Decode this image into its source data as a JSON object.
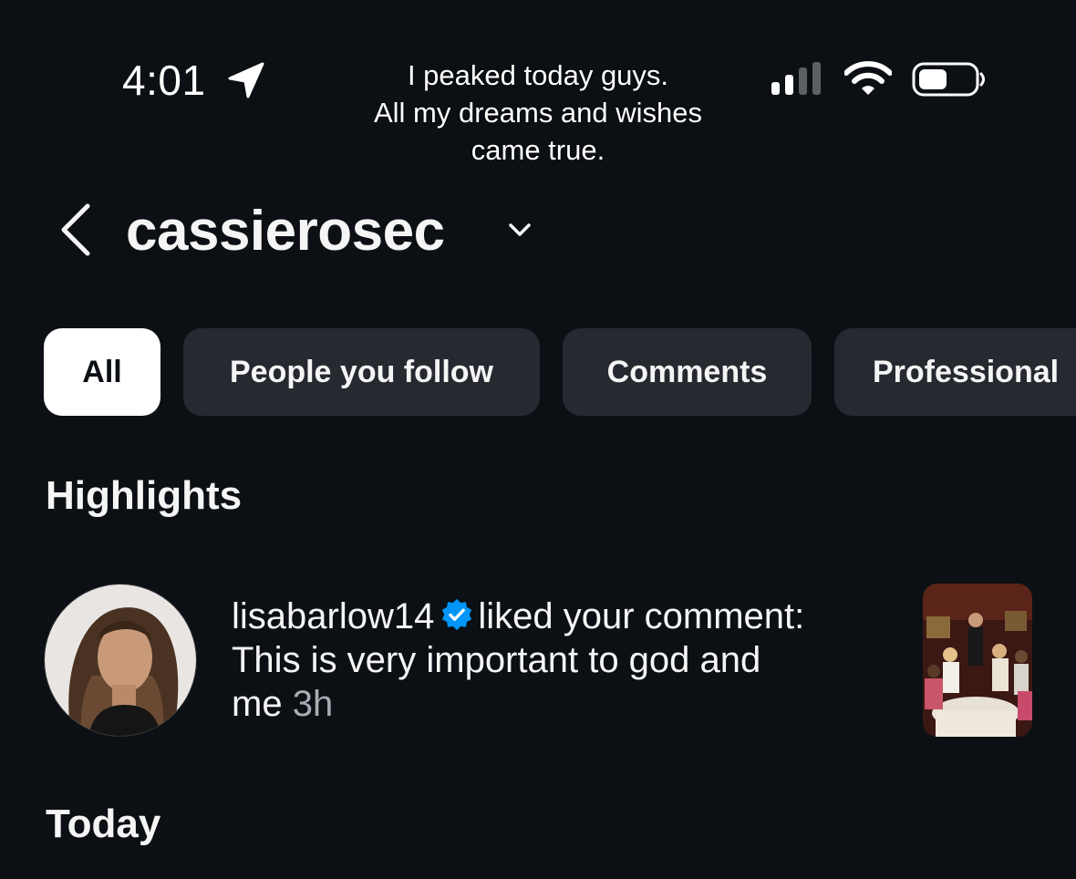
{
  "status_bar": {
    "time": "4:01",
    "caption_lines": [
      "I peaked today guys.",
      "All my dreams and wishes",
      "came true."
    ],
    "location_icon": "location-arrow-icon",
    "signal_icon": "cellular-signal-icon",
    "wifi_icon": "wifi-icon",
    "battery_icon": "battery-icon"
  },
  "header": {
    "username": "cassierosec",
    "back_icon": "chevron-left-icon",
    "account_switch_icon": "chevron-down-icon"
  },
  "filters": [
    {
      "label": "All",
      "active": true
    },
    {
      "label": "People you follow",
      "active": false
    },
    {
      "label": "Comments",
      "active": false
    },
    {
      "label": "Professional",
      "active": false
    }
  ],
  "sections": {
    "highlights": "Highlights",
    "today": "Today"
  },
  "notification": {
    "username": "lisabarlow14",
    "verified": true,
    "action": "liked your comment:",
    "comment_line1": "This is very important to god and",
    "comment_line2": "me",
    "time_ago": "3h"
  },
  "colors": {
    "background": "#0c1014",
    "chip": "#262a30",
    "chip_active": "#ffffff",
    "verified_blue": "#0095f6",
    "muted_text": "#a8acb3"
  }
}
